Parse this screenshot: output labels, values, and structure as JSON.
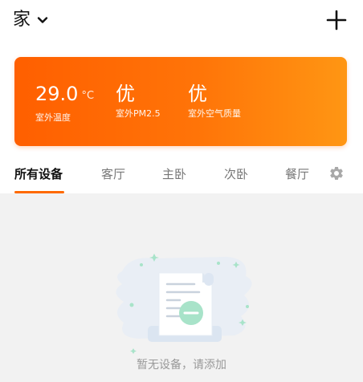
{
  "header": {
    "home_name": "家",
    "home_dropdown_icon": "chevron-down-icon",
    "add_icon": "plus-icon"
  },
  "weather": {
    "temperature_value": "29.0",
    "temperature_unit": "°C",
    "temperature_label": "室外温度",
    "pm25_value": "优",
    "pm25_label": "室外PM2.5",
    "air_quality_value": "优",
    "air_quality_label": "室外空气质量",
    "gradient_start": "#ff5f00",
    "gradient_end": "#ff9613"
  },
  "tabs": [
    {
      "label": "所有设备",
      "active": true
    },
    {
      "label": "客厅",
      "active": false
    },
    {
      "label": "主卧",
      "active": false
    },
    {
      "label": "次卧",
      "active": false
    },
    {
      "label": "餐厅",
      "active": false
    }
  ],
  "tabs_settings_icon": "gear-icon",
  "empty_state": {
    "message": "暂无设备，请添加",
    "illustration": "empty-document-icon"
  },
  "colors": {
    "accent": "#ff6a00"
  }
}
